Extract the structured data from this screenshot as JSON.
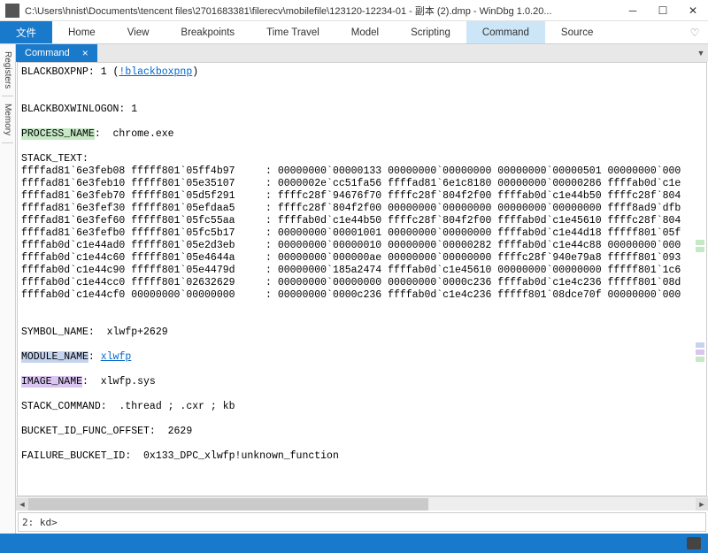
{
  "window": {
    "title": "C:\\Users\\hnist\\Documents\\tencent files\\2701683381\\filerecv\\mobilefile\\123120-12234-01 - 副本 (2).dmp - WinDbg 1.0.20..."
  },
  "menu": {
    "file": "文件",
    "home": "Home",
    "view": "View",
    "breakpoints": "Breakpoints",
    "timetravel": "Time Travel",
    "model": "Model",
    "scripting": "Scripting",
    "command": "Command",
    "source": "Source"
  },
  "sidetabs": {
    "registers": "Registers",
    "memory": "Memory"
  },
  "doctab": {
    "label": "Command",
    "close": "×"
  },
  "console": {
    "l1a": "BLACKBOXPNP: 1 (",
    "l1link": "!blackboxpnp",
    "l1b": ")",
    "l2": "BLACKBOXWINLOGON: 1",
    "l3key": "PROCESS_NAME",
    "l3val": ":  chrome.exe",
    "l4": "STACK_TEXT:  ",
    "s0": "ffffad81`6e3feb08 fffff801`05ff4b97     : 00000000`00000133 00000000`00000000 00000000`00000501 00000000`000",
    "s1": "ffffad81`6e3feb10 fffff801`05e35107     : 0000002e`cc51fa56 ffffad81`6e1c8180 00000000`00000286 ffffab0d`c1e",
    "s2": "ffffad81`6e3feb70 fffff801`05d5f291     : ffffc28f`94676f70 ffffc28f`804f2f00 ffffab0d`c1e44b50 ffffc28f`804",
    "s3": "ffffad81`6e3fef30 fffff801`05efdaa5     : ffffc28f`804f2f00 00000000`00000000 00000000`00000000 ffff8ad9`dfb",
    "s4": "ffffad81`6e3fef60 fffff801`05fc55aa     : ffffab0d`c1e44b50 ffffc28f`804f2f00 ffffab0d`c1e45610 ffffc28f`804",
    "s5": "ffffad81`6e3fefb0 fffff801`05fc5b17     : 00000000`00001001 00000000`00000000 ffffab0d`c1e44d18 fffff801`05f",
    "s6": "ffffab0d`c1e44ad0 fffff801`05e2d3eb     : 00000000`00000010 00000000`00000282 ffffab0d`c1e44c88 00000000`000",
    "s7": "ffffab0d`c1e44c60 fffff801`05e4644a     : 00000000`000000ae 00000000`00000000 ffffc28f`940e79a8 fffff801`093",
    "s8": "ffffab0d`c1e44c90 fffff801`05e4479d     : 00000000`185a2474 ffffab0d`c1e45610 00000000`00000000 fffff801`1c6",
    "s9": "ffffab0d`c1e44cc0 fffff801`02632629     : 00000000`00000000 00000000`0000c236 ffffab0d`c1e4c236 fffff801`08d",
    "s10": "ffffab0d`c1e44cf0 00000000`00000000     : 00000000`0000c236 ffffab0d`c1e4c236 fffff801`08dce70f 00000000`000",
    "sym": "SYMBOL_NAME:  xlwfp+2629",
    "modkey": "MODULE_NAME",
    "modsep": ": ",
    "modlink": "xlwfp",
    "imgkey": "IMAGE_NAME",
    "imgval": ":  xlwfp.sys",
    "stackcmd": "STACK_COMMAND:  .thread ; .cxr ; kb",
    "bucketoff": "BUCKET_ID_FUNC_OFFSET:  2629",
    "failbucket": "FAILURE_BUCKET_ID:  0x133_DPC_xlwfp!unknown_function"
  },
  "prompt": {
    "label": "2: kd>",
    "value": ""
  },
  "colors": {
    "accent": "#1979ca",
    "hl_green": "#c5e8c5",
    "hl_blue": "#c5d3ef",
    "hl_purple": "#d9c5ef"
  }
}
